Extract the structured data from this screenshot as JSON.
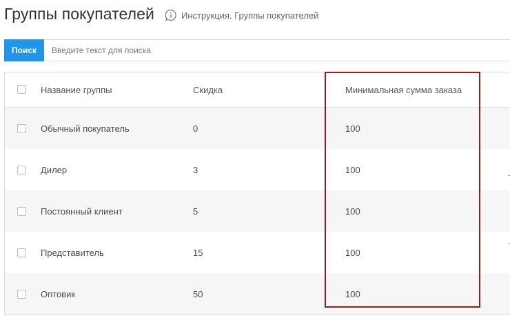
{
  "header": {
    "title": "Группы покупателей",
    "help_text": "Инструкция. Группы покупателей"
  },
  "search": {
    "button_label": "Поиск",
    "placeholder": "Введите текст для поиска",
    "value": ""
  },
  "table": {
    "columns": {
      "name": "Название группы",
      "discount": "Скидка",
      "min_order": "Минимальная сумма заказа"
    },
    "rows": [
      {
        "name": "Обычный покупатель",
        "discount": "0",
        "min_order": "100"
      },
      {
        "name": "Дилер",
        "discount": "3",
        "min_order": "100"
      },
      {
        "name": "Постоянный клиент",
        "discount": "5",
        "min_order": "100"
      },
      {
        "name": "Представитель",
        "discount": "15",
        "min_order": "100"
      },
      {
        "name": "Оптовик",
        "discount": "50",
        "min_order": "100"
      }
    ]
  },
  "colors": {
    "accent": "#2196e8",
    "highlight_border": "#9b1c1c",
    "row_alt": "#f6f6f6"
  }
}
